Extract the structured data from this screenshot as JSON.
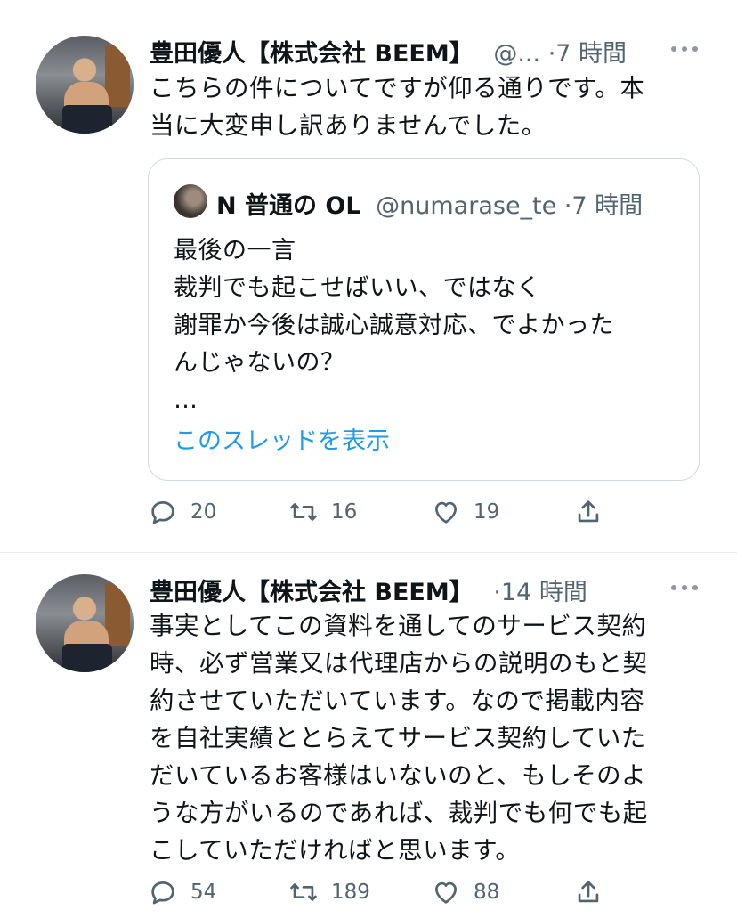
{
  "tweets": [
    {
      "author": "豊田優人【株式会社 BEEM】",
      "handle": "@...",
      "time": "·7 時間",
      "text": "こちらの件についてですが仰る通りです。本\n当に大変申し訳ありませんでした。",
      "quote": {
        "author": "N 普通の OL",
        "handle": "@numarase_te",
        "time": "·7 時間",
        "text": "最後の一言\n裁判でも起こせばいい、ではなく\n謝罪か今後は誠心誠意対応、でよかった\nんじゃないの？\n…",
        "link": "このスレッドを表示"
      },
      "actions": {
        "reply": "20",
        "retweet": "16",
        "like": "19"
      }
    },
    {
      "author": "豊田優人【株式会社 BEEM】",
      "time": "·14 時間",
      "text": "事実としてこの資料を通してのサービス契約\n時、必ず営業又は代理店からの説明のもと契\n約させていただいています。なので掲載内容\nを自社実績ととらえてサービス契約していた\nだいているお客様はいないのと、もしそのよ\nうな方がいるのであれば、裁判でも何でも起\nこしていただければと思います。",
      "actions": {
        "reply": "54",
        "retweet": "189",
        "like": "88"
      }
    }
  ],
  "icons": {
    "reply": "reply-icon",
    "retweet": "retweet-icon",
    "like": "heart-icon",
    "share": "share-icon",
    "more": "more-icon"
  },
  "colors": {
    "link": "#1d9bf0",
    "meta": "#536471"
  }
}
